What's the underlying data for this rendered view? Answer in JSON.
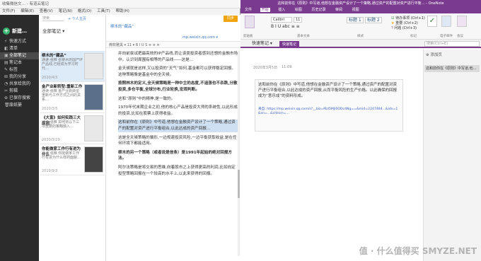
{
  "left_app": {
    "title": "收集微信文… - 有道云笔记",
    "menu": [
      "文件(F)",
      "编辑(E)",
      "查看(V)",
      "笔记(N)",
      "格式(O)",
      "工具(T)",
      "帮助(H)"
    ],
    "new_label": "新建…",
    "sync_label": "同步",
    "sidebar": {
      "items": [
        {
          "icon": "⚡",
          "label": "快速方式"
        },
        {
          "icon": "◧",
          "label": "清单"
        },
        {
          "icon": "▣",
          "label": "全部笔记"
        },
        {
          "icon": "▤",
          "label": "笔记本"
        },
        {
          "icon": "✎",
          "label": "标签"
        },
        {
          "icon": "⊞",
          "label": "我的分享"
        },
        {
          "icon": "◔",
          "label": "共享给我的"
        },
        {
          "icon": "✂",
          "label": "剪辑"
        },
        {
          "icon": "⊕",
          "label": "已保存搜索"
        },
        {
          "icon": "🗑",
          "label": "废纸篓"
        }
      ]
    },
    "search_placeholder": "搜索",
    "add_note_label": "+ 个人主页",
    "list_title": "全部笔记 ▾",
    "notes": [
      {
        "title": "柳木的“藏品”",
        "snippet": "通读·强推 张柳木的国产IP产品线,已经成为学习时代…",
        "date": "2020/4/3"
      },
      {
        "title": "金产业新转型:重新工作",
        "snippet": "通读·强推 金产业新转型重新与工作方式之间的关系…",
        "date": "2020/3/5"
      },
      {
        "title": "《大富》如何实践三大原则",
        "snippet": "通读·强推 如何将以下三项重要的策略融入…",
        "date": "2020/3/29"
      },
      {
        "title": "你能做家工作行有进为什么",
        "snippet": "通读·强推 你能做家工作行有进为什么样的面貌…",
        "date": "2019/9/3"
      }
    ],
    "editor": {
      "title": "柳木的“藏品”",
      "url": "mp.weixin.qq.com ▾",
      "toolbar": "微软雅黑 ▾  11 ▾  B I U S  ≡ ≡ ≡",
      "paragraphs": [
        {
          "style": "",
          "text": "并向前尝试把最高效的IP产品线,而让该类投资者感到还想的金融市场中。认识到周围有相等的产品线——这是…"
        },
        {
          "style": "",
          "text": "金天候就是这样,又以投资的“天气”如何,基金都可以获得稳定回报。这种策略像是基金中的全天候。"
        },
        {
          "style": "b",
          "text": "按照林木的定义,全天候策略是一种中立的态度,不追涨也不杀跌,分散投资,多仓平衡,全球分布,行业轮换,宏观判断。"
        },
        {
          "style": "",
          "text": "这和“原则”中的精神,是一致的。"
        },
        {
          "style": "",
          "text": "1970年代末期企业之初,他的核心产品是投资大师的系统性,以此形成的投资,比如在股票上获得收益。"
        },
        {
          "style": "hl",
          "text": "这和前你在《原则》中写道,他想在金融资产设计了一个策略,通过资产的配置对资产进行平衡组合,以此达成的资产回报…"
        },
        {
          "style": "",
          "text": "这是全天候策略的雏形,一边规避投资风险,一边平衡获取收益,是在任何环境下都能适用。"
        },
        {
          "style": "b",
          "text": "柳木的另一个策略（或者说是信条）是1991年起始的绝对回报方法。"
        },
        {
          "style": "",
          "text": "阿尔法策略是将交易的思维,向着股市之上获得更高的利润,比如向定投型策略回报在一个较高的水平上,以此来获得的回报。"
        }
      ]
    }
  },
  "right_app": {
    "title": "这和前你在《原则》中写道,他想在金融资产设计了一个策略,通过资产的配置对资产进行平衡… - OneNote",
    "tabs": [
      "文件",
      "开始",
      "插入",
      "绘图",
      "历史记录",
      "审阅",
      "视图"
    ],
    "ribbon": {
      "font": "Calibri",
      "size": "11",
      "styles": [
        {
          "label": "标题 1"
        },
        {
          "label": "标题 2"
        }
      ],
      "checks": [
        "待办事项 (Ctrl+1)",
        "重要 (Ctrl+2)",
        "问题 (Ctrl+3)"
      ],
      "group_labels": [
        "剪贴板",
        "基本文本",
        "样式",
        "标记",
        "电子邮件",
        "会议"
      ]
    },
    "notebook": "快速笔记 ▾",
    "section": "快速笔记",
    "search_placeholder": "搜索(Ctrl+E)",
    "add_page": "⊕ 添加页",
    "page_entry": "这和前你在《原则》中写道,他…",
    "date": "2020年3月5日",
    "time": "11:09",
    "clip_text": "这和前你在《原则》中写道,他想在金融资产设计了一个策略,通过资产的配置对资产进行平衡组合,以此达成的资产回报,从而平衡风险的生产价格。以此确保的回报成为“意乐成”的资料形成。",
    "clip_source": "来自: https://mp.weixin.qq.com/s?__biz=MzI5MjI0ODc4Ng==&mid=2247484...&idx=1&sn=...&chksm=..."
  },
  "watermark": "值 · 什么值得买 SMYZE.NET"
}
